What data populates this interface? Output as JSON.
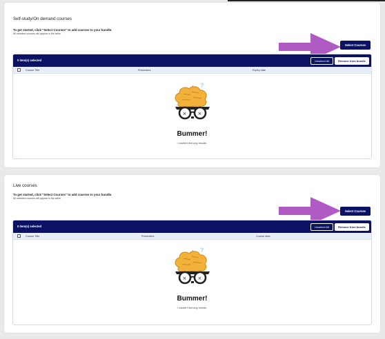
{
  "sections": [
    {
      "title": "Self-study/On demand courses",
      "help": "To get started, click \"Select Courses\" to add courses to your bundle.",
      "sub": "All selected courses will appear in the table.",
      "select_button": "Select Courses",
      "selected_count": "0 item(s) selected",
      "unselect_all": "Unselect All",
      "remove_from_bundle": "Remove from bundle",
      "columns": [
        "Course Title",
        "Presenters",
        "Expiry date"
      ],
      "empty_title": "Bummer!",
      "empty_text": "I couldn't find any results."
    },
    {
      "title": "Live courses",
      "help": "To get started, click \"Select Courses\" to add courses to your bundle.",
      "sub": "All selected courses will appear in the table.",
      "select_button": "Select Courses",
      "selected_count": "0 item(s) selected",
      "unselect_all": "Unselect All",
      "remove_from_bundle": "Remove from bundle",
      "columns": [
        "Course Title",
        "Presenters",
        "Course date"
      ],
      "empty_title": "Bummer!",
      "empty_text": "I couldn't find any results."
    }
  ],
  "colors": {
    "navy": "#0b1263",
    "arrow": "#b05bc4",
    "brain": "#f2b13b",
    "header": "#e7edf9"
  },
  "icons": {
    "arrow": "arrow-right-icon",
    "empty": "confused-brain-icon",
    "checkbox": "checkbox-icon"
  }
}
